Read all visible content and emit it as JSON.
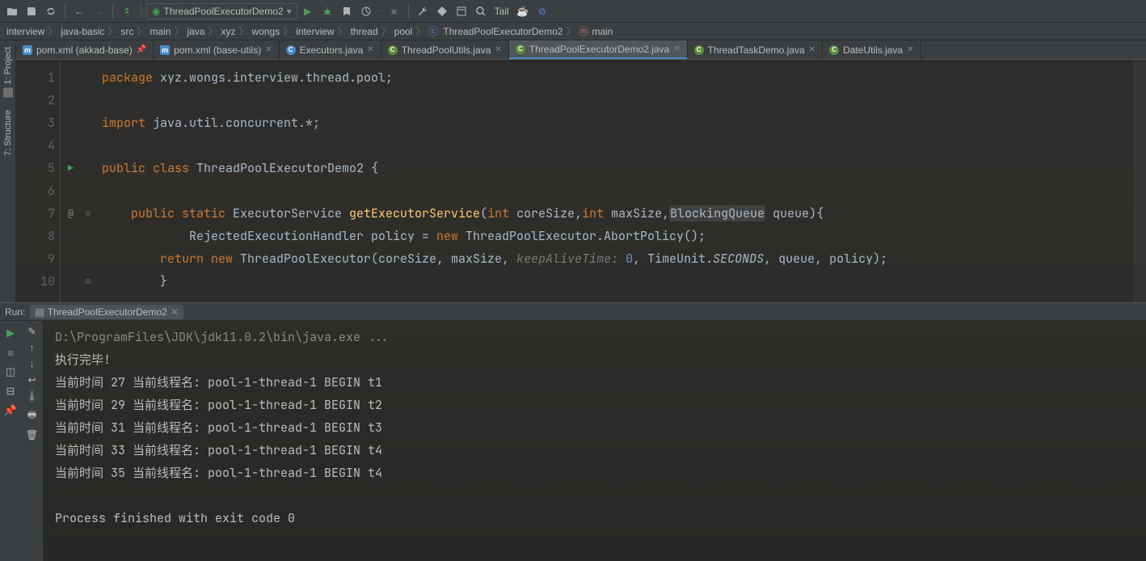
{
  "toolbar": {
    "run_config": "ThreadPoolExecutorDemo2",
    "tail": "Tail"
  },
  "breadcrumb": [
    "interview",
    "java-basic",
    "src",
    "main",
    "java",
    "xyz",
    "wongs",
    "interview",
    "thread",
    "pool",
    "ThreadPoolExecutorDemo2",
    "main"
  ],
  "left_tabs": {
    "project": "1: Project",
    "structure": "7: Structure"
  },
  "tabs": [
    {
      "label": "pom.xml (akkad-base)",
      "type": "mvn",
      "pinned": true
    },
    {
      "label": "pom.xml (base-utils)",
      "type": "mvn"
    },
    {
      "label": "Executors.java",
      "type": "cblue"
    },
    {
      "label": "ThreadPoolUtils.java",
      "type": "c"
    },
    {
      "label": "ThreadPoolExecutorDemo2.java",
      "type": "c",
      "active": true
    },
    {
      "label": "ThreadTaskDemo.java",
      "type": "c"
    },
    {
      "label": "DateUtils.java",
      "type": "c"
    }
  ],
  "code": {
    "lines": [
      "1",
      "2",
      "3",
      "4",
      "5",
      "6",
      "7",
      "8",
      "9",
      "10"
    ],
    "line1_kw1": "package",
    "line1_pkg": " xyz.wongs.interview.thread.pool;",
    "line3_kw": "import",
    "line3_rest": " java.util.concurrent.*;",
    "line5_kw1": "public class ",
    "line5_cls": "ThreadPoolExecutorDemo2",
    "line5_rest": " {",
    "line7_kw": "public static ",
    "line7_ret": "ExecutorService ",
    "line7_fn": "getExecutorService",
    "line7_p1": "(",
    "line7_kw2": "int",
    "line7_p2": " coreSize,",
    "line7_kw3": "int",
    "line7_p3": " maxSize,",
    "line7_hl": "BlockingQueue",
    "line7_p4": " queue){",
    "line8": "            RejectedExecutionHandler policy = ",
    "line8_kw": "new",
    "line8_rest": " ThreadPoolExecutor.AbortPolicy();",
    "line9_kw1": "return new ",
    "line9_cls": "ThreadPoolExecutor",
    "line9_p": "(coreSize, maxSize, ",
    "line9_hint": "keepAliveTime: ",
    "line9_num": "0",
    "line9_mid": ", TimeUnit.",
    "line9_em": "SECONDS",
    "line9_rest": ", queue, policy);",
    "line10": "        }"
  },
  "run": {
    "label": "Run:",
    "tab": "ThreadPoolExecutorDemo2",
    "console": [
      "D:\\ProgramFiles\\JDK\\jdk11.0.2\\bin\\java.exe ...",
      "执行完毕!",
      "当前时间 27 当前线程名: pool-1-thread-1 BEGIN t1",
      "当前时间 29 当前线程名: pool-1-thread-1 BEGIN t2",
      "当前时间 31 当前线程名: pool-1-thread-1 BEGIN t3",
      "当前时间 33 当前线程名: pool-1-thread-1 BEGIN t4",
      "当前时间 35 当前线程名: pool-1-thread-1 BEGIN t4",
      "",
      "Process finished with exit code 0"
    ]
  }
}
